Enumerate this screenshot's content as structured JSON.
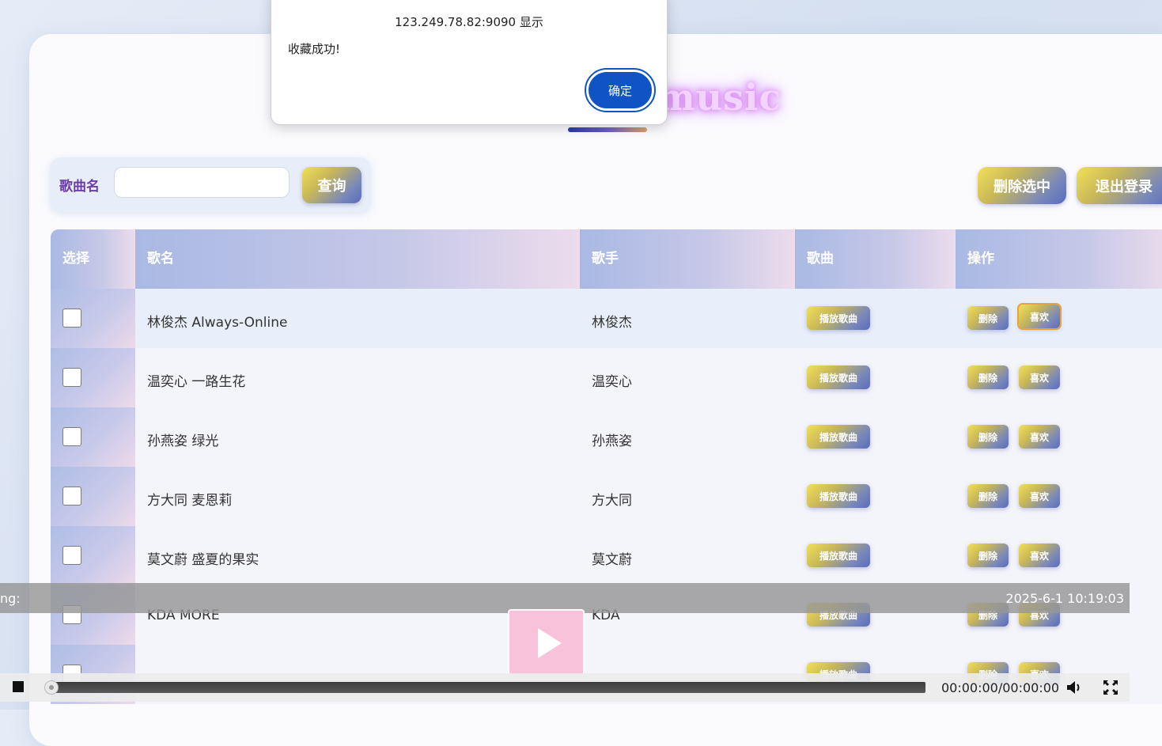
{
  "app": {
    "brand": "music"
  },
  "search": {
    "label": "歌曲名",
    "value": "",
    "button": "查询"
  },
  "actions": {
    "delete_selected": "删除选中",
    "logout": "退出登录"
  },
  "table": {
    "headers": [
      "选择",
      "歌名",
      "歌手",
      "歌曲",
      "操作"
    ],
    "play_label": "播放歌曲",
    "delete_label": "删除",
    "like_label": "喜欢",
    "rows": [
      {
        "song": "林俊杰 Always-Online",
        "singer": "林俊杰"
      },
      {
        "song": "温奕心 一路生花",
        "singer": "温奕心"
      },
      {
        "song": "孙燕姿 绿光",
        "singer": "孙燕姿"
      },
      {
        "song": "方大同 麦恩莉",
        "singer": "方大同"
      },
      {
        "song": "莫文蔚 盛夏的果实",
        "singer": "莫文蔚"
      },
      {
        "song": "KDA MORE",
        "singer": "KDA"
      },
      {
        "song": "",
        "singer": ""
      }
    ]
  },
  "player": {
    "now_playing": "ng:",
    "datetime": "2025-6-1 10:19:03",
    "time": "00:00:00/00:00:00",
    "progress": 0
  },
  "dialog": {
    "title": "123.249.78.82:9090 显示",
    "message": "收藏成功!",
    "ok": "确定"
  },
  "colors": {
    "accent_blue": "#0f53c4",
    "header_gradient_start": "#a9b9e4",
    "button_gradient_start": "#f1e05a",
    "button_gradient_end": "#5a6cbf",
    "label_purple": "#6a3fa8"
  }
}
